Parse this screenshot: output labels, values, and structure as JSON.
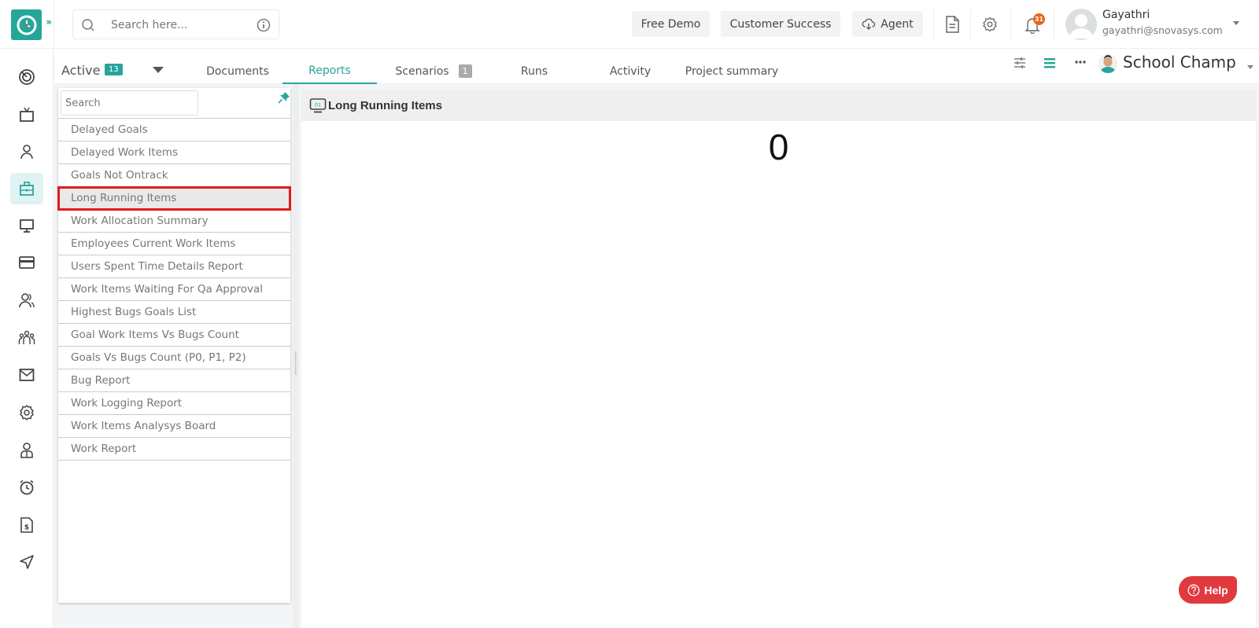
{
  "header": {
    "search_placeholder": "Search here...",
    "buttons": {
      "free_demo": "Free Demo",
      "customer_success": "Customer Success",
      "agent": "Agent"
    },
    "notification_count": "31",
    "user": {
      "name": "Gayathri",
      "email": "gayathri@snovasys.com"
    }
  },
  "sidebar": {
    "items": [
      {
        "icon": "dashboard-target-icon",
        "label": "Dashboard"
      },
      {
        "icon": "tv-icon",
        "label": "Live"
      },
      {
        "icon": "user-icon",
        "label": "Profile"
      },
      {
        "icon": "briefcase-icon",
        "label": "Projects",
        "active": true
      },
      {
        "icon": "monitor-icon",
        "label": "Activity tracker"
      },
      {
        "icon": "credit-card-icon",
        "label": "Billing"
      },
      {
        "icon": "users-icon",
        "label": "HR"
      },
      {
        "icon": "team-icon",
        "label": "Team"
      },
      {
        "icon": "mail-icon",
        "label": "Messages"
      },
      {
        "icon": "settings-icon",
        "label": "Settings"
      },
      {
        "icon": "employee-icon",
        "label": "Employees"
      },
      {
        "icon": "alarm-clock-icon",
        "label": "Timesheet"
      },
      {
        "icon": "invoice-icon",
        "label": "Invoices"
      },
      {
        "icon": "send-icon",
        "label": "Send"
      }
    ]
  },
  "tabsbar": {
    "active_label": "Active",
    "active_count": "13",
    "tabs": [
      {
        "label": "Documents"
      },
      {
        "label": "Reports",
        "active": true
      },
      {
        "label": "Scenarios",
        "badge": "1"
      },
      {
        "label": "Runs"
      },
      {
        "label": "Activity"
      },
      {
        "label": "Project summary"
      }
    ],
    "project_name": "School Champ"
  },
  "report_list": {
    "search_placeholder": "Search",
    "items": [
      "Delayed Goals",
      "Delayed Work Items",
      "Goals Not Ontrack",
      "Long Running Items",
      "Work Allocation Summary",
      "Employees Current Work Items",
      "Users Spent Time Details Report",
      "Work Items Waiting For Qa Approval",
      "Highest Bugs Goals List",
      "Goal Work Items Vs Bugs Count",
      "Goals Vs Bugs Count (P0, P1, P2)",
      "Bug Report",
      "Work Logging Report",
      "Work Items Analysys Board",
      "Work Report"
    ],
    "selected_index": 3
  },
  "report": {
    "title": "Long Running Items",
    "value": "0"
  },
  "help": {
    "label": "Help"
  },
  "colors": {
    "accent": "#26a69a",
    "selection_outline": "#e01b1b",
    "help_button": "#e03a3e",
    "notification_badge": "#e8651a"
  }
}
